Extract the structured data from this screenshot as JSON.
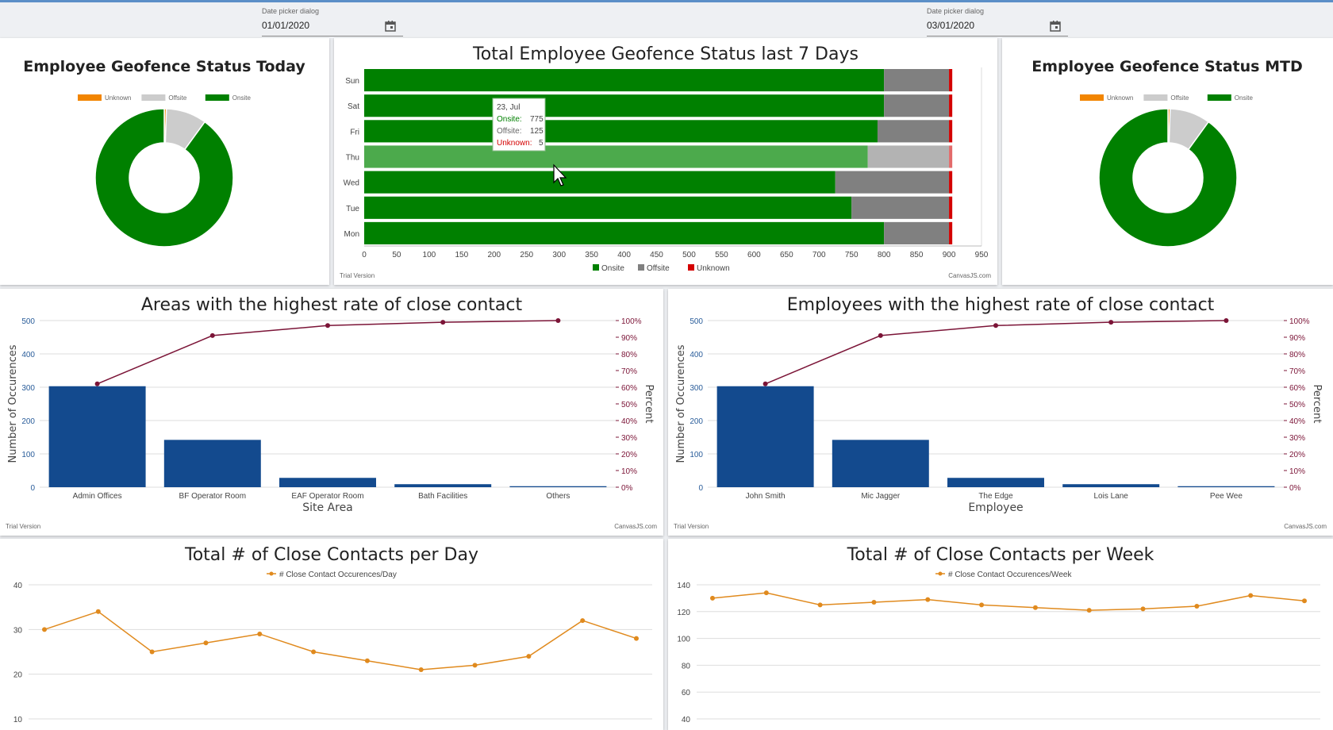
{
  "date_pickers": [
    {
      "label": "Date picker dialog",
      "value": "01/01/2020"
    },
    {
      "label": "Date picker dialog",
      "value": "03/01/2020"
    }
  ],
  "branding": {
    "trial": "Trial Version",
    "credit": "CanvasJS.com"
  },
  "colors": {
    "onsite": "#008000",
    "offsite": "#808080",
    "offsite_light": "#cccccc",
    "unknown": "#d40000",
    "unknown_orange": "#f28500",
    "bar_blue": "#134a8e",
    "pareto_line": "#7b1437",
    "line_orange": "#e08a1e"
  },
  "geofence_today": {
    "title": "Employee Geofence Status Today",
    "legend": [
      {
        "label": "Unknown",
        "color": "#f28500"
      },
      {
        "label": "Offsite",
        "color": "#cccccc"
      },
      {
        "label": "Onsite",
        "color": "#008000"
      }
    ],
    "chart_data": {
      "type": "pie",
      "labels": [
        "Unknown",
        "Offsite",
        "Onsite"
      ],
      "values": [
        0.5,
        9.5,
        90
      ]
    }
  },
  "geofence_mtd": {
    "title": "Employee Geofence Status MTD",
    "legend": [
      {
        "label": "Unknown",
        "color": "#f28500"
      },
      {
        "label": "Offsite",
        "color": "#cccccc"
      },
      {
        "label": "Onsite",
        "color": "#008000"
      }
    ],
    "chart_data": {
      "type": "pie",
      "labels": [
        "Unknown",
        "Offsite",
        "Onsite"
      ],
      "values": [
        0.5,
        9.5,
        90
      ]
    }
  },
  "geofence_7days": {
    "title": "Total Employee Geofence Status last 7 Days",
    "chart_data": {
      "type": "bar",
      "orientation": "horizontal-stacked",
      "categories": [
        "Sun",
        "Sat",
        "Fri",
        "Thu",
        "Wed",
        "Tue",
        "Mon"
      ],
      "series": [
        {
          "name": "Onsite",
          "values": [
            800,
            800,
            790,
            775,
            725,
            750,
            800
          ]
        },
        {
          "name": "Offsite",
          "values": [
            100,
            100,
            110,
            125,
            175,
            150,
            100
          ]
        },
        {
          "name": "Unknown",
          "values": [
            5,
            5,
            5,
            5,
            5,
            5,
            5
          ]
        }
      ],
      "xlim": [
        0,
        950
      ],
      "xticks": [
        0,
        50,
        100,
        150,
        200,
        250,
        300,
        350,
        400,
        450,
        500,
        550,
        600,
        650,
        700,
        750,
        800,
        850,
        900,
        950
      ],
      "legend_position": "bottom"
    },
    "tooltip": {
      "title": "23, Jul",
      "rows": [
        {
          "label": "Onsite:",
          "value": "775"
        },
        {
          "label": "Offsite:",
          "value": "125"
        },
        {
          "label": "Unknown:",
          "value": "5"
        }
      ]
    }
  },
  "areas_contact": {
    "title": "Areas with the highest rate of close contact",
    "chart_data": {
      "type": "bar",
      "categories": [
        "Admin Offices",
        "BF Operator Room",
        "EAF Operator Room",
        "Bath Facilities",
        "Others"
      ],
      "values": [
        303,
        142,
        28,
        9,
        3
      ],
      "pareto_percent": [
        62,
        91,
        97,
        99,
        100
      ],
      "xlabel": "Site Area",
      "ylabel": "Number of Occurences",
      "y2label": "Percent",
      "ylim": [
        0,
        500
      ],
      "yticks": [
        0,
        100,
        200,
        300,
        400,
        500
      ],
      "y2ticks": [
        "0%",
        "10%",
        "20%",
        "30%",
        "40%",
        "50%",
        "60%",
        "70%",
        "80%",
        "90%",
        "100%"
      ]
    }
  },
  "employees_contact": {
    "title": "Employees with the highest rate of close contact",
    "chart_data": {
      "type": "bar",
      "categories": [
        "John Smith",
        "Mic Jagger",
        "The Edge",
        "Lois Lane",
        "Pee Wee"
      ],
      "values": [
        303,
        142,
        28,
        9,
        3
      ],
      "pareto_percent": [
        62,
        91,
        97,
        99,
        100
      ],
      "xlabel": "Employee",
      "ylabel": "Number of Occurences",
      "y2label": "Percent",
      "ylim": [
        0,
        500
      ],
      "yticks": [
        0,
        100,
        200,
        300,
        400,
        500
      ],
      "y2ticks": [
        "0%",
        "10%",
        "20%",
        "30%",
        "40%",
        "50%",
        "60%",
        "70%",
        "80%",
        "90%",
        "100%"
      ]
    }
  },
  "contacts_day": {
    "title": "Total # of Close Contacts per Day",
    "chart_data": {
      "type": "line",
      "series": [
        {
          "name": "# Close Contact Occurences/Day",
          "values": [
            30,
            34,
            25,
            27,
            29,
            25,
            23,
            21,
            22,
            24,
            32,
            28
          ]
        }
      ],
      "ylim": [
        10,
        40
      ],
      "yticks": [
        10,
        20,
        30,
        40
      ]
    }
  },
  "contacts_week": {
    "title": "Total # of Close Contacts per Week",
    "chart_data": {
      "type": "line",
      "series": [
        {
          "name": "# Close Contact Occurences/Week",
          "values": [
            130,
            134,
            125,
            127,
            129,
            125,
            123,
            121,
            122,
            124,
            132,
            128
          ]
        }
      ],
      "ylim": [
        40,
        140
      ],
      "yticks": [
        40,
        60,
        80,
        100,
        120,
        140
      ]
    }
  }
}
